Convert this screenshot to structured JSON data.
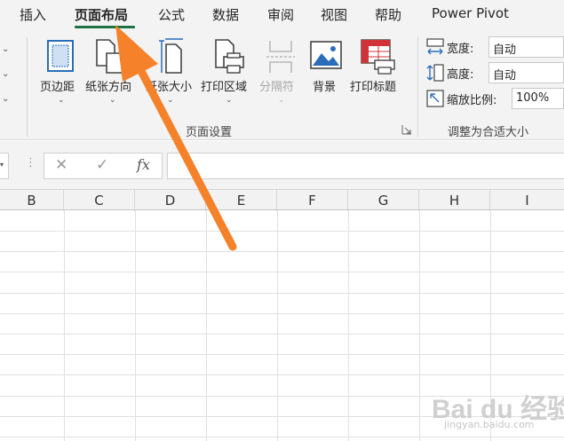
{
  "tabs": [
    {
      "label": "插入",
      "active": false
    },
    {
      "label": "页面布局",
      "active": true
    },
    {
      "label": "公式",
      "active": false
    },
    {
      "label": "数据",
      "active": false
    },
    {
      "label": "审阅",
      "active": false
    },
    {
      "label": "视图",
      "active": false
    },
    {
      "label": "帮助",
      "active": false
    },
    {
      "label": "Power Pivot",
      "active": false
    }
  ],
  "page_setup": {
    "group_label": "页面设置",
    "buttons": [
      {
        "label": "页边距",
        "icon": "margins-icon",
        "enabled": true
      },
      {
        "label": "纸张方向",
        "icon": "orientation-icon",
        "enabled": true
      },
      {
        "label": "纸张大小",
        "icon": "size-icon",
        "enabled": true
      },
      {
        "label": "打印区域",
        "icon": "print-area-icon",
        "enabled": true
      },
      {
        "label": "分隔符",
        "icon": "breaks-icon",
        "enabled": false
      },
      {
        "label": "背景",
        "icon": "background-icon",
        "enabled": true
      },
      {
        "label": "打印标题",
        "icon": "print-titles-icon",
        "enabled": true
      }
    ]
  },
  "scale_to_fit": {
    "group_label": "调整为合适大小",
    "width": {
      "label": "宽度:",
      "value": "自动"
    },
    "height": {
      "label": "高度:",
      "value": "自动"
    },
    "scale": {
      "label": "缩放比例:",
      "value": "100%"
    }
  },
  "formula_bar": {
    "cancel": "✕",
    "enter": "✓",
    "function": "fx",
    "value": ""
  },
  "columns": [
    "B",
    "C",
    "D",
    "E",
    "F",
    "G",
    "H",
    "I"
  ],
  "watermark": {
    "name": "Bai du 经验",
    "url": "jingyan.baidu.com"
  },
  "colors": {
    "accent": "#1f7244",
    "arrow": "#f5822a",
    "icon_blue": "#2a6ebb",
    "icon_red": "#d13438"
  }
}
